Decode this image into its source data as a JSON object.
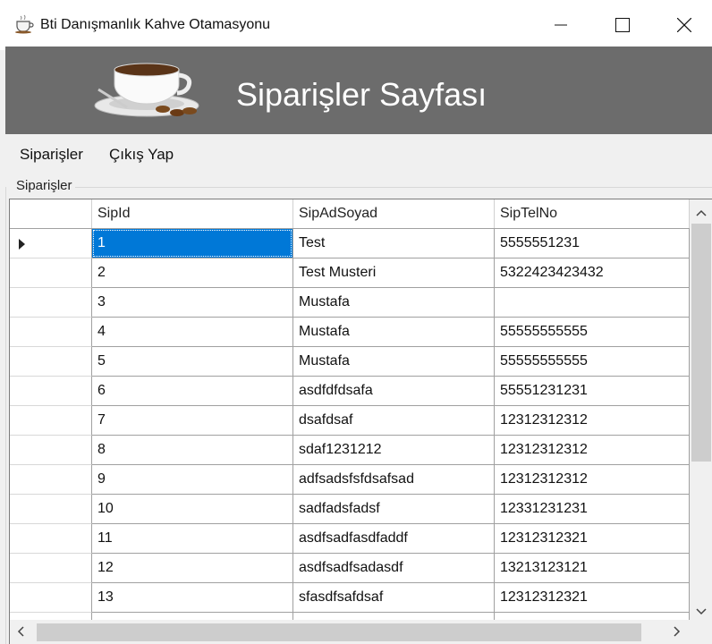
{
  "window": {
    "title": "Bti Danışmanlık Kahve Otamasyonu",
    "icon": "coffee-cup-icon"
  },
  "header": {
    "title": "Siparişler Sayfası",
    "image": "coffee-cup-image"
  },
  "menu": {
    "items": [
      {
        "label": "Siparişler"
      },
      {
        "label": "Çıkış Yap"
      }
    ]
  },
  "group": {
    "label": "Siparişler"
  },
  "grid": {
    "columns": [
      "SipId",
      "SipAdSoyad",
      "SipTelNo"
    ],
    "rows": [
      {
        "id": "1",
        "name": "Test",
        "tel": "5555551231"
      },
      {
        "id": "2",
        "name": "Test Musteri",
        "tel": "5322423423432"
      },
      {
        "id": "3",
        "name": "Mustafa",
        "tel": ""
      },
      {
        "id": "4",
        "name": "Mustafa",
        "tel": "55555555555"
      },
      {
        "id": "5",
        "name": "Mustafa",
        "tel": "55555555555"
      },
      {
        "id": "6",
        "name": "asdfdfdsafa",
        "tel": "55551231231"
      },
      {
        "id": "7",
        "name": "dsafdsaf",
        "tel": "12312312312"
      },
      {
        "id": "8",
        "name": "sdaf1231212",
        "tel": "12312312312"
      },
      {
        "id": "9",
        "name": "adfsadsfsfdsafsad",
        "tel": "12312312312"
      },
      {
        "id": "10",
        "name": "sadfadsfadsf",
        "tel": "12331231231"
      },
      {
        "id": "11",
        "name": "asdfsadfasdfaddf",
        "tel": "12312312321"
      },
      {
        "id": "12",
        "name": "asdfsadfsadasdf",
        "tel": "13213123121"
      },
      {
        "id": "13",
        "name": "sfasdfsafdsaf",
        "tel": "12312312321"
      }
    ],
    "selected_row_index": 0
  },
  "colors": {
    "header_bg": "#6c6c6c",
    "selection": "#0078d7"
  }
}
